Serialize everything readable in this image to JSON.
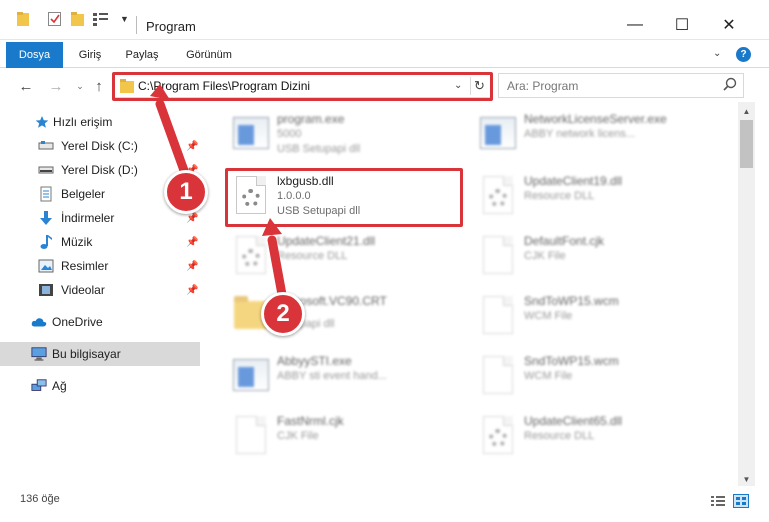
{
  "window": {
    "title": "Program"
  },
  "ribbon": {
    "tabs": [
      "Dosya",
      "Giriş",
      "Paylaş",
      "Görünüm"
    ],
    "help": "?"
  },
  "address": {
    "path": "C:\\Program Files\\Program Dizini",
    "search_placeholder": "Ara: Program"
  },
  "sidebar": {
    "items": [
      {
        "label": "Hızlı erişim",
        "icon": "star-icon"
      },
      {
        "label": "Yerel Disk (C:)",
        "icon": "drive-icon",
        "pinned": true
      },
      {
        "label": "Yerel Disk (D:)",
        "icon": "drive-icon",
        "pinned": true
      },
      {
        "label": "Belgeler",
        "icon": "documents-icon",
        "pinned": true
      },
      {
        "label": "İndirmeler",
        "icon": "downloads-icon",
        "pinned": true
      },
      {
        "label": "Müzik",
        "icon": "music-icon",
        "pinned": true
      },
      {
        "label": "Resimler",
        "icon": "pictures-icon",
        "pinned": true
      },
      {
        "label": "Videolar",
        "icon": "videos-icon",
        "pinned": true
      },
      {
        "label": "OneDrive",
        "icon": "cloud-icon"
      },
      {
        "label": "Bu bilgisayar",
        "icon": "computer-icon",
        "selected": true
      },
      {
        "label": "Ağ",
        "icon": "network-icon"
      }
    ]
  },
  "files": [
    {
      "name": "program.exe",
      "line1": "5000",
      "line2": "USB Setupapi dll",
      "icon": "exe-icon"
    },
    {
      "name": "NetworkLicenseServer.exe",
      "line1": "ABBY network licens...",
      "line2": "",
      "icon": "exe-icon"
    },
    {
      "name": "lxbgusb.dll",
      "line1": "1.0.0.0",
      "line2": "USB Setupapi dll",
      "icon": "dll-icon"
    },
    {
      "name": "UpdateClient19.dll",
      "line1": "Resource DLL",
      "line2": "",
      "icon": "dll-icon"
    },
    {
      "name": "UpdateClient21.dll",
      "line1": "Resource DLL",
      "line2": "",
      "icon": "dll-icon"
    },
    {
      "name": "DefaultFont.cjk",
      "line1": "CJK File",
      "line2": "",
      "icon": "file-icon"
    },
    {
      "name": "Microsoft.VC90.CRT",
      "line1": "Setupapi dll",
      "line2": "",
      "icon": "folder-icon"
    },
    {
      "name": "SndToWP15.wcm",
      "line1": "WCM File",
      "line2": "",
      "icon": "file-icon"
    },
    {
      "name": "AbbyySTI.exe",
      "line1": "ABBY sti event hand...",
      "line2": "",
      "icon": "exe-icon"
    },
    {
      "name": "SndToWP15.wcm",
      "line1": "WCM File",
      "line2": "",
      "icon": "file-icon"
    },
    {
      "name": "FastNrml.cjk",
      "line1": "CJK File",
      "line2": "",
      "icon": "file-icon"
    },
    {
      "name": "UpdateClient65.dll",
      "line1": "Resource DLL",
      "line2": "",
      "icon": "dll-icon"
    }
  ],
  "status": {
    "count": "136 öğe"
  },
  "annotations": {
    "step1": "1",
    "step2": "2",
    "color": "#d9343a"
  },
  "colors": {
    "accent": "#1979ca",
    "folder": "#f2c64b"
  }
}
